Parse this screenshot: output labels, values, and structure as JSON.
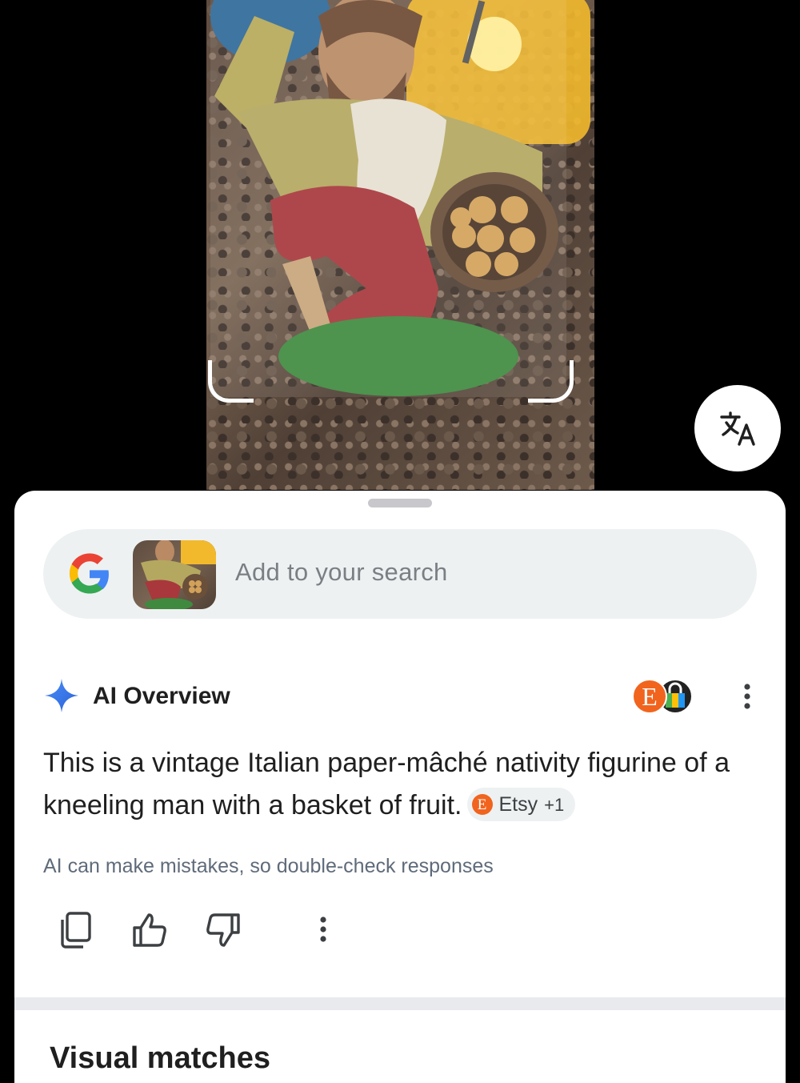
{
  "search": {
    "placeholder": "Add to your search"
  },
  "ai_overview": {
    "title": "AI Overview",
    "text": "This is a vintage Italian paper-mâché nativity figurine of a kneeling man with a basket of fruit.",
    "source_chip": {
      "label": "Etsy",
      "extra": "+1"
    },
    "disclaimer": "AI can make mistakes, so double-check responses"
  },
  "sections": {
    "visual_matches": "Visual matches"
  },
  "icons": {
    "translate": "translate-icon",
    "google": "google-logo",
    "ai": "sparkle-icon",
    "copy": "copy-icon",
    "thumbs_up": "thumbs-up-icon",
    "thumbs_down": "thumbs-down-icon",
    "more": "more-vert-icon"
  },
  "colors": {
    "accent_blue": "#3b7bf0",
    "etsy_orange": "#f1641e"
  }
}
